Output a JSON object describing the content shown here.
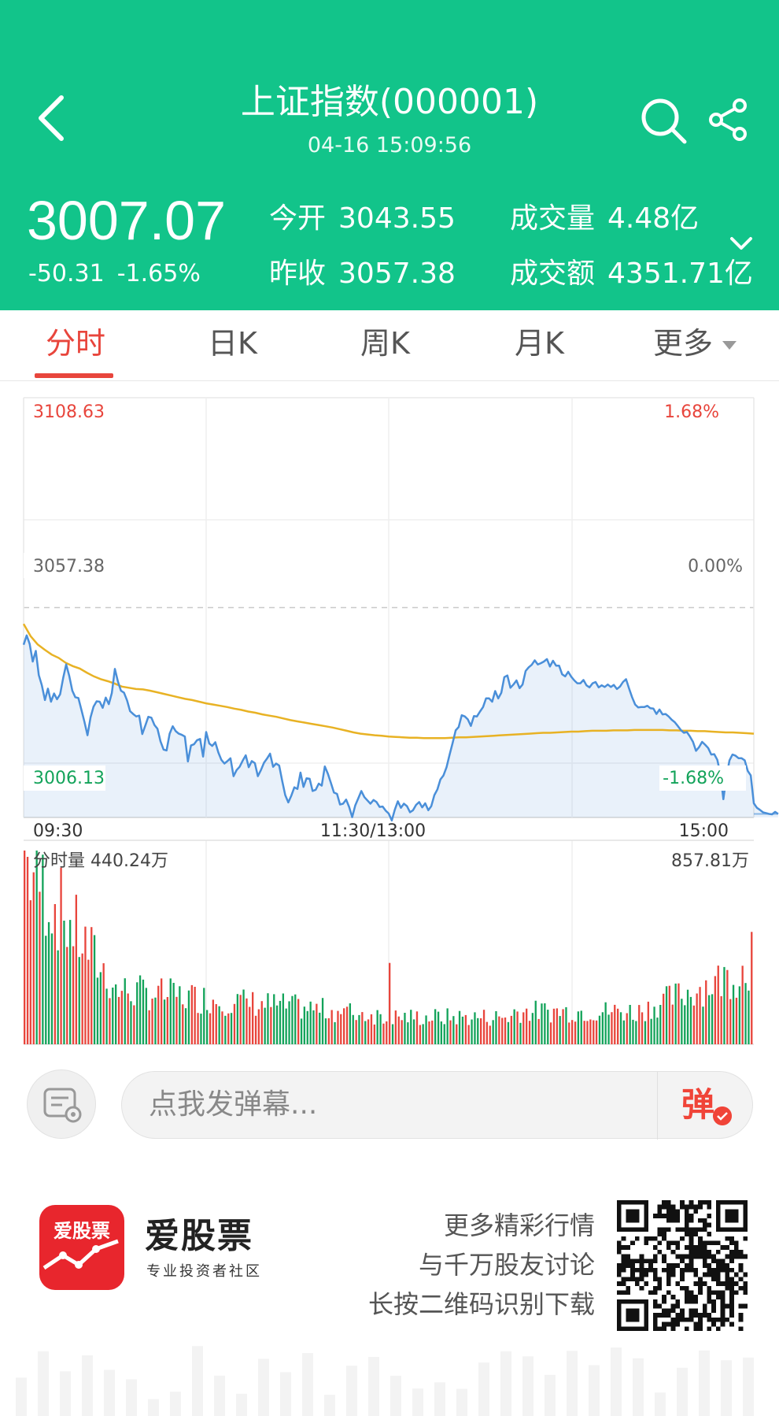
{
  "header": {
    "title": "上证指数(000001)",
    "datetime": "04-16 15:09:56",
    "price": "3007.07",
    "change": "-50.31",
    "change_pct": "-1.65%",
    "stats": [
      {
        "label": "今开",
        "value": "3043.55"
      },
      {
        "label": "成交量",
        "value": "4.48亿"
      },
      {
        "label": "昨收",
        "value": "3057.38"
      },
      {
        "label": "成交额",
        "value": "4351.71亿"
      }
    ]
  },
  "tabs": [
    {
      "label": "分时",
      "active": true
    },
    {
      "label": "日K",
      "active": false
    },
    {
      "label": "周K",
      "active": false
    },
    {
      "label": "月K",
      "active": false
    },
    {
      "label": "更多",
      "active": false
    }
  ],
  "chart_data": {
    "type": "line",
    "price_axis": {
      "high": "3108.63",
      "mid": "3057.38",
      "low": "3006.13"
    },
    "pct_axis": {
      "high": "1.68%",
      "mid": "0.00%",
      "low": "-1.68%"
    },
    "x_ticks": [
      "09:30",
      "11:30/13:00",
      "15:00"
    ],
    "ylim": [
      3006.13,
      3108.63
    ],
    "prev_close": 3057.38,
    "price_series": [
      3048.3,
      3050.6,
      3048.5,
      3044.2,
      3046.8,
      3040.9,
      3038.4,
      3034.8,
      3037.6,
      3034.4,
      3036.4,
      3035.0,
      3036.2,
      3040.2,
      3043.5,
      3040.7,
      3037.1,
      3035.5,
      3035.3,
      3032.4,
      3029.5,
      3026.2,
      3030.6,
      3033.2,
      3034.5,
      3034.4,
      3032.9,
      3035.4,
      3033.8,
      3036.5,
      3042.4,
      3039.3,
      3037.1,
      3036.6,
      3034.7,
      3032.1,
      3031.4,
      3030.8,
      3031.0,
      3026.5,
      3028.6,
      3030.7,
      3030.5,
      3028.7,
      3027.8,
      3024.7,
      3022.7,
      3022.5,
      3026.6,
      3028.4,
      3027.2,
      3026.6,
      3026.3,
      3025.9,
      3019.8,
      3023.7,
      3024.0,
      3025.0,
      3025.3,
      3021.0,
      3027.0,
      3024.2,
      3023.6,
      3024.5,
      3022.0,
      3020.2,
      3019.3,
      3019.9,
      3020.6,
      3016.2,
      3017.7,
      3018.5,
      3020.0,
      3021.3,
      3018.4,
      3019.9,
      3019.4,
      3016.2,
      3017.7,
      3019.5,
      3020.5,
      3021.7,
      3018.5,
      3019.3,
      3018.8,
      3015.0,
      3011.6,
      3009.8,
      3011.5,
      3013.5,
      3013.1,
      3017.1,
      3013.6,
      3015.7,
      3015.6,
      3012.6,
      3012.9,
      3014.4,
      3013.9,
      3018.6,
      3016.8,
      3014.6,
      3012.2,
      3011.9,
      3009.3,
      3009.5,
      3010.5,
      3008.7,
      3006.2,
      3009.1,
      3010.8,
      3012.6,
      3011.1,
      3010.3,
      3009.5,
      3010.4,
      3009.9,
      3008.7,
      3008.8,
      3007.8,
      3007.1,
      3005.4,
      3008.0,
      3010.1,
      3008.5,
      3009.5,
      3008.9,
      3007.4,
      3007.9,
      3009.2,
      3009.9,
      3008.6,
      3009.6,
      3007.9,
      3008.9,
      3011.6,
      3013.0,
      3015.4,
      3016.4,
      3018.4,
      3021.4,
      3024.3,
      3027.4,
      3028.2,
      3031.1,
      3030.8,
      3030.1,
      3028.5,
      3030.9,
      3030.8,
      3032.0,
      3033.1,
      3035.2,
      3035.2,
      3034.4,
      3037.0,
      3035.2,
      3036.6,
      3040.4,
      3040.8,
      3037.8,
      3038.6,
      3039.6,
      3037.7,
      3038.6,
      3041.9,
      3042.8,
      3043.4,
      3044.5,
      3043.5,
      3043.8,
      3044.2,
      3044.8,
      3043.0,
      3044.4,
      3043.2,
      3043.2,
      3041.1,
      3040.6,
      3041.7,
      3040.5,
      3039.6,
      3038.9,
      3038.9,
      3039.7,
      3038.4,
      3037.9,
      3038.9,
      3039.2,
      3037.9,
      3038.4,
      3038.0,
      3038.6,
      3038.0,
      3038.5,
      3037.5,
      3038.1,
      3039.2,
      3039.9,
      3037.6,
      3035.5,
      3033.7,
      3033.0,
      3033.1,
      3033.1,
      3033.4,
      3032.8,
      3032.7,
      3031.4,
      3032.5,
      3031.3,
      3031.4,
      3030.8,
      3030.0,
      3029.4,
      3028.5,
      3027.5,
      3026.8,
      3027.0,
      3025.9,
      3024.6,
      3022.4,
      3023.3,
      3024.6,
      3023.9,
      3023.1,
      3021.5,
      3021.6,
      3020.2,
      3016.8,
      3010.6,
      3016.1,
      3020.1,
      3021.5,
      3021.2,
      3020.6,
      3020.6,
      3020.1,
      3017.5,
      3016.4,
      3009.6,
      3008.5,
      3008.0,
      3007.4,
      3007.2,
      3007.0,
      3006.9,
      3007.5,
      3007.0
    ],
    "avg_series": [
      3053.4,
      3050.4,
      3048.4,
      3047.1,
      3045.9,
      3045.1,
      3043.9,
      3043.1,
      3042.5,
      3041.5,
      3040.6,
      3039.9,
      3039.4,
      3038.8,
      3038.1,
      3037.8,
      3037.5,
      3037.4,
      3037.1,
      3036.7,
      3036.3,
      3035.9,
      3035.5,
      3035.1,
      3034.8,
      3034.4,
      3034.0,
      3033.7,
      3033.4,
      3033.1,
      3032.7,
      3032.4,
      3032.0,
      3031.7,
      3031.3,
      3031.0,
      3030.7,
      3030.3,
      3029.9,
      3029.6,
      3029.3,
      3029.0,
      3028.7,
      3028.4,
      3028.1,
      3027.7,
      3027.3,
      3026.9,
      3026.6,
      3026.4,
      3026.2,
      3026.1,
      3025.9,
      3025.8,
      3025.7,
      3025.6,
      3025.6,
      3025.5,
      3025.5,
      3025.5,
      3025.5,
      3025.6,
      3025.7,
      3025.7,
      3025.8,
      3025.9,
      3026.0,
      3026.1,
      3026.2,
      3026.3,
      3026.4,
      3026.5,
      3026.6,
      3026.7,
      3026.8,
      3026.8,
      3026.9,
      3027.0,
      3027.1,
      3027.1,
      3027.2,
      3027.3,
      3027.3,
      3027.3,
      3027.4,
      3027.4,
      3027.4,
      3027.5,
      3027.5,
      3027.5,
      3027.5,
      3027.5,
      3027.4,
      3027.4,
      3027.3,
      3027.3,
      3027.2,
      3027.2,
      3027.1,
      3027.0,
      3026.9,
      3026.9,
      3026.8,
      3026.7,
      3026.6
    ],
    "volume_label": "分时量 440.24万",
    "volume_max": "857.81万"
  },
  "barrage": {
    "placeholder": "点我发弹幕...",
    "send_label": "弹"
  },
  "ad": {
    "logo_text": "爱股票",
    "app_name": "爱股票",
    "slogan": "专业投资者社区",
    "lines": [
      "更多精彩行情",
      "与千万股友讨论",
      "长按二维码识别下载"
    ]
  },
  "colors": {
    "header_bg": "#12c48a",
    "up": "#e8453c",
    "down": "#13a35a",
    "price_line": "#4a8fd9",
    "avg_line": "#e8b224"
  }
}
